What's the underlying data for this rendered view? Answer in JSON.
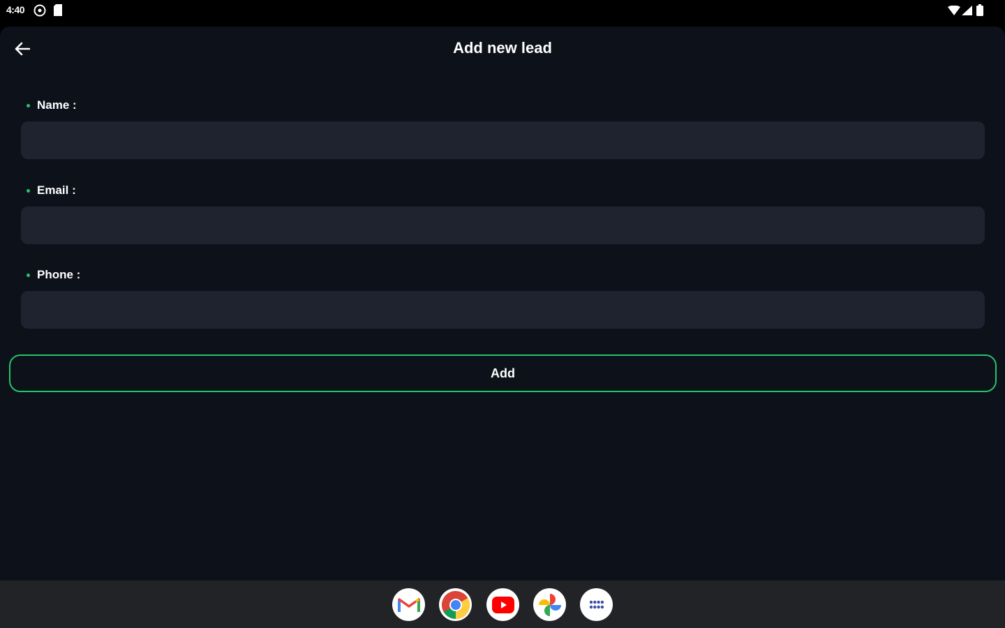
{
  "status_bar": {
    "time": "4:40",
    "icons": [
      "settings-icon",
      "sd-card-icon",
      "wifi-icon",
      "signal-icon",
      "battery-icon"
    ]
  },
  "header": {
    "back_icon": "arrow-back-icon",
    "title": "Add new lead"
  },
  "form": {
    "fields": [
      {
        "label": "Name :",
        "value": "",
        "placeholder": ""
      },
      {
        "label": "Email :",
        "value": "",
        "placeholder": ""
      },
      {
        "label": "Phone :",
        "value": "",
        "placeholder": ""
      }
    ],
    "submit_label": "Add"
  },
  "taskbar": {
    "apps": [
      "gmail-icon",
      "chrome-icon",
      "youtube-icon",
      "photos-icon",
      "app-drawer-icon"
    ]
  },
  "colors": {
    "background": "#0d111a",
    "input_background": "#1f2330",
    "accent": "#25c46a",
    "taskbar": "#222326"
  }
}
